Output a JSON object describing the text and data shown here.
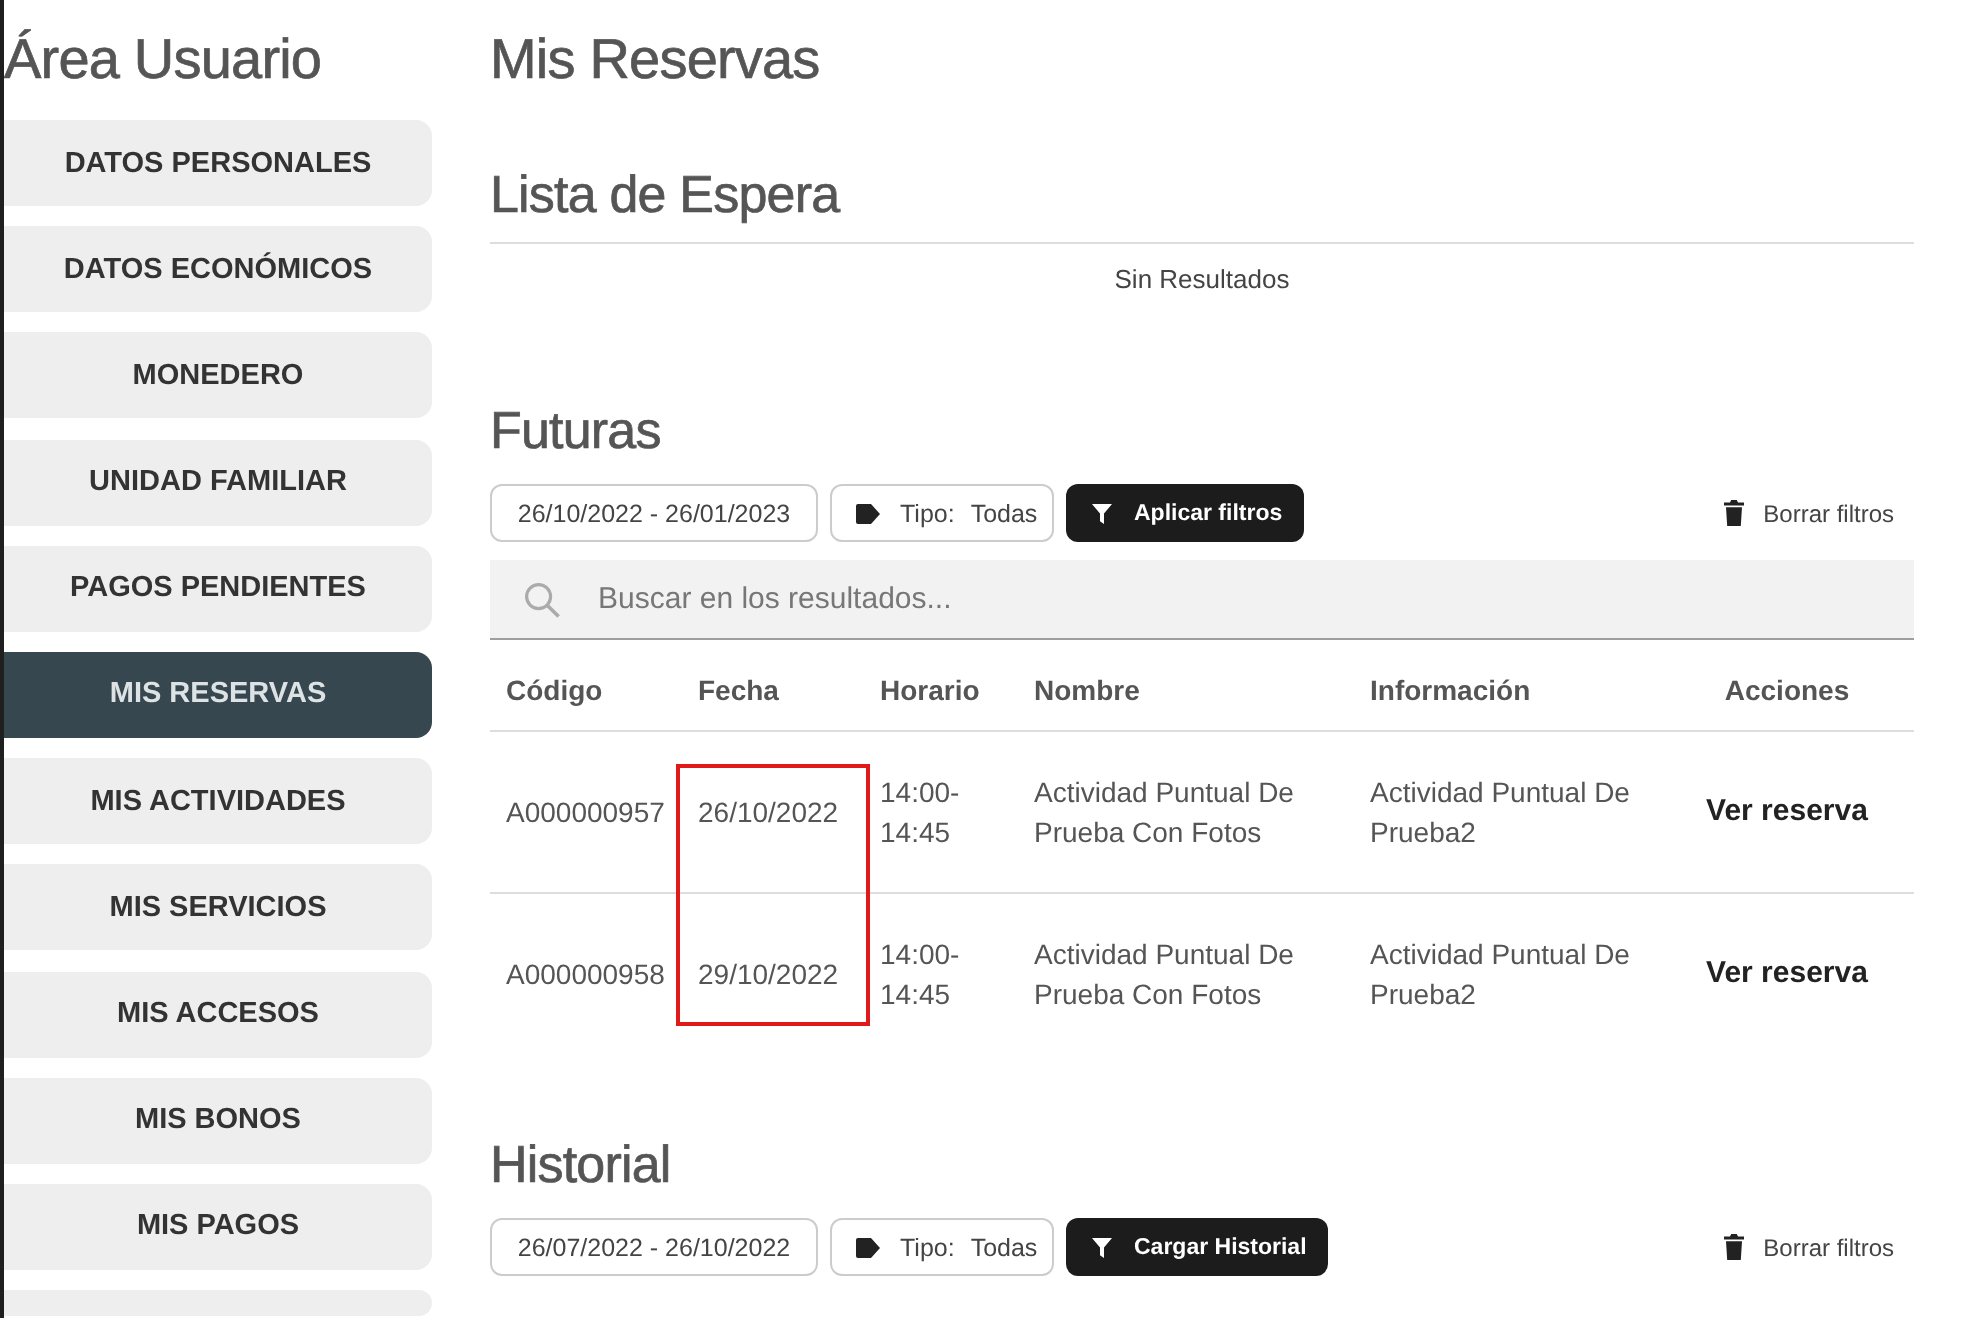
{
  "sidebar": {
    "title": "Área Usuario",
    "items": [
      {
        "label": "DATOS PERSONALES",
        "selected": false
      },
      {
        "label": "DATOS ECONÓMICOS",
        "selected": false
      },
      {
        "label": "MONEDERO",
        "selected": false
      },
      {
        "label": "UNIDAD FAMILIAR",
        "selected": false
      },
      {
        "label": "PAGOS PENDIENTES",
        "selected": false
      },
      {
        "label": "MIS RESERVAS",
        "selected": true
      },
      {
        "label": "MIS ACTIVIDADES",
        "selected": false
      },
      {
        "label": "MIS SERVICIOS",
        "selected": false
      },
      {
        "label": "MIS ACCESOS",
        "selected": false
      },
      {
        "label": "MIS BONOS",
        "selected": false
      },
      {
        "label": "MIS PAGOS",
        "selected": false
      }
    ]
  },
  "page_title": "Mis Reservas",
  "waiting_list": {
    "title": "Lista de Espera",
    "empty_message": "Sin Resultados"
  },
  "upcoming": {
    "title": "Futuras",
    "filters": {
      "date_range": "26/10/2022 - 26/01/2023",
      "type_label": "Tipo:",
      "type_value": "Todas",
      "submit_button": "Aplicar filtros",
      "clear_button": "Borrar filtros"
    },
    "search": {
      "placeholder": "Buscar en los resultados..."
    },
    "table": {
      "columns": [
        {
          "label": "Código",
          "kind": "text",
          "highlighted": false
        },
        {
          "label": "Fecha",
          "kind": "text",
          "highlighted": true
        },
        {
          "label": "Horario",
          "kind": "text",
          "highlighted": false
        },
        {
          "label": "Nombre",
          "kind": "text",
          "highlighted": false
        },
        {
          "label": "Información",
          "kind": "text",
          "highlighted": false
        },
        {
          "label": "Acciones",
          "kind": "action",
          "highlighted": false
        }
      ],
      "rows": [
        {
          "cells": [
            "A000000957",
            "26/10/2022",
            "14:00-\n14:45",
            "Actividad Puntual De Prueba Con Fotos",
            "Actividad Puntual De Prueba2",
            "Ver reserva"
          ]
        },
        {
          "cells": [
            "A000000958",
            "29/10/2022",
            "14:00-\n14:45",
            "Actividad Puntual De Prueba Con Fotos",
            "Actividad Puntual De Prueba2",
            "Ver reserva"
          ]
        }
      ]
    }
  },
  "history": {
    "title": "Historial",
    "filters": {
      "date_range": "26/07/2022 - 26/10/2022",
      "type_label": "Tipo:",
      "type_value": "Todas",
      "submit_button": "Cargar Historial",
      "clear_button": "Borrar filtros"
    }
  }
}
